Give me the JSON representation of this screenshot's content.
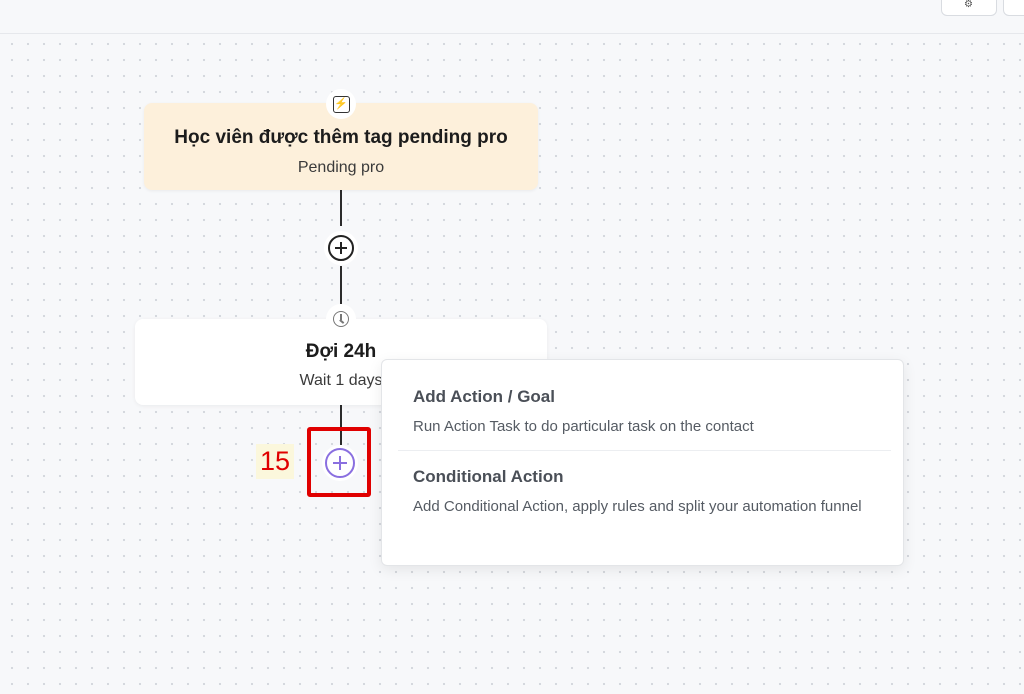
{
  "trigger": {
    "title": "Học viên được thêm tag pending pro",
    "subtitle": "Pending pro",
    "icon": "lightning-icon"
  },
  "wait": {
    "title": "Đợi 24h",
    "subtitle": "Wait 1 days",
    "icon": "clock-icon"
  },
  "step_marker": "15",
  "menu": {
    "options": [
      {
        "title": "Add Action / Goal",
        "description": "Run Action Task to do particular task on the contact"
      },
      {
        "title": "Conditional Action",
        "description": "Add Conditional Action, apply rules and split your automation funnel"
      }
    ]
  },
  "colors": {
    "trigger_bg": "#fdf0db",
    "accent_purple": "#8a6fe0",
    "highlight_red": "#e00000"
  }
}
